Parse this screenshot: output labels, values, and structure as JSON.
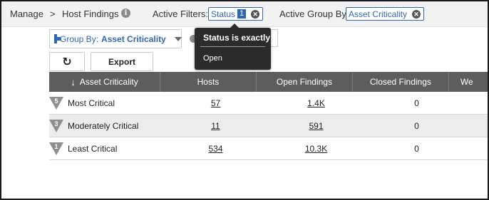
{
  "breadcrumb": {
    "manage": "Manage",
    "separator": ">",
    "page": "Host Findings",
    "info_icon": "i"
  },
  "filters": {
    "label": "Active Filters:",
    "chip_label": "Status",
    "chip_count": "1",
    "remove_icon": "✕"
  },
  "group": {
    "label": "Active Group By:",
    "chip_label": "Asset Criticality",
    "remove_icon": "✕"
  },
  "tooltip": {
    "title": "Status is exactly",
    "value": "Open"
  },
  "groupby_control": {
    "label": "Group By:",
    "value": "Asset Criticality"
  },
  "toolbar": {
    "refresh_icon": "↻",
    "export_label": "Export"
  },
  "table": {
    "sort_icon": "↓",
    "columns": [
      "Asset Criticality",
      "Hosts",
      "Open Findings",
      "Closed Findings",
      "We"
    ],
    "rows": [
      {
        "level": "5",
        "name": "Most Critical",
        "hosts": "57",
        "open": "1.4K",
        "closed": "0"
      },
      {
        "level": "3",
        "name": "Moderately Critical",
        "hosts": "11",
        "open": "591",
        "closed": "0"
      },
      {
        "level": "1",
        "name": "Least Critical",
        "hosts": "534",
        "open": "10.3K",
        "closed": "0"
      }
    ]
  },
  "colors": {
    "accent": "#2f66b4",
    "header_bg": "#5d5d5d",
    "tooltip_bg": "#2b2b2b"
  }
}
